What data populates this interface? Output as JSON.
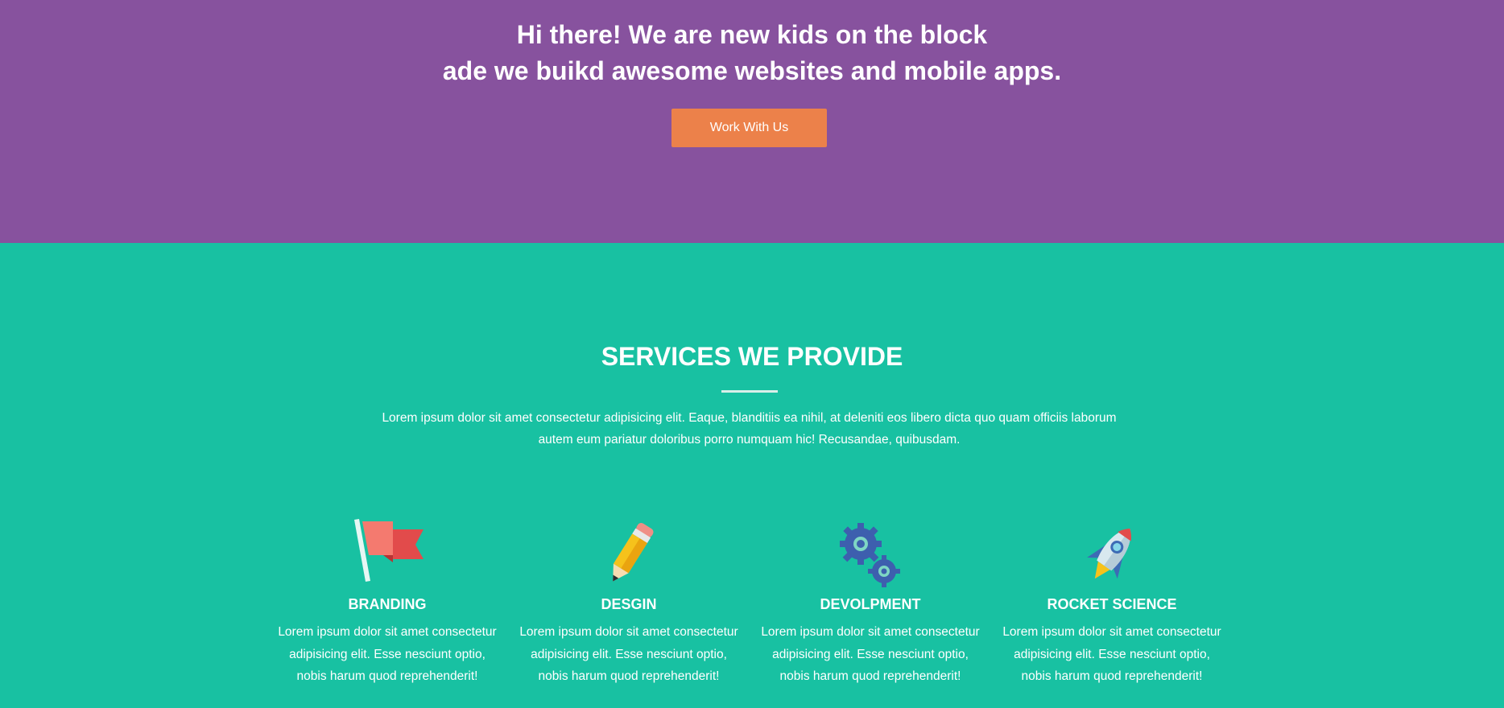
{
  "hero": {
    "headline_line1": "Hi there! We are new kids on the block",
    "headline_line2": "ade we buikd awesome websites and mobile apps.",
    "cta_label": "Work With Us"
  },
  "services": {
    "title": "SERVICES WE PROVIDE",
    "intro": "Lorem ipsum dolor sit amet consectetur adipisicing elit. Eaque, blanditiis ea nihil, at deleniti eos libero dicta quo quam officiis laborum autem eum pariatur doloribus porro numquam hic! Recusandae, quibusdam.",
    "items": [
      {
        "icon": "flag-icon",
        "title": "BRANDING",
        "text": "Lorem ipsum dolor sit amet consectetur adipisicing elit. Esse nesciunt optio, nobis harum quod reprehenderit!"
      },
      {
        "icon": "pencil-icon",
        "title": "DESGIN",
        "text": "Lorem ipsum dolor sit amet consectetur adipisicing elit. Esse nesciunt optio, nobis harum quod reprehenderit!"
      },
      {
        "icon": "gears-icon",
        "title": "DEVOLPMENT",
        "text": "Lorem ipsum dolor sit amet consectetur adipisicing elit. Esse nesciunt optio, nobis harum quod reprehenderit!"
      },
      {
        "icon": "rocket-icon",
        "title": "ROCKET SCIENCE",
        "text": "Lorem ipsum dolor sit amet consectetur adipisicing elit. Esse nesciunt optio, nobis harum quod reprehenderit!"
      }
    ]
  },
  "colors": {
    "hero_bg": "#87529e",
    "services_bg": "#18c1a2",
    "cta_bg": "#ec814a"
  }
}
